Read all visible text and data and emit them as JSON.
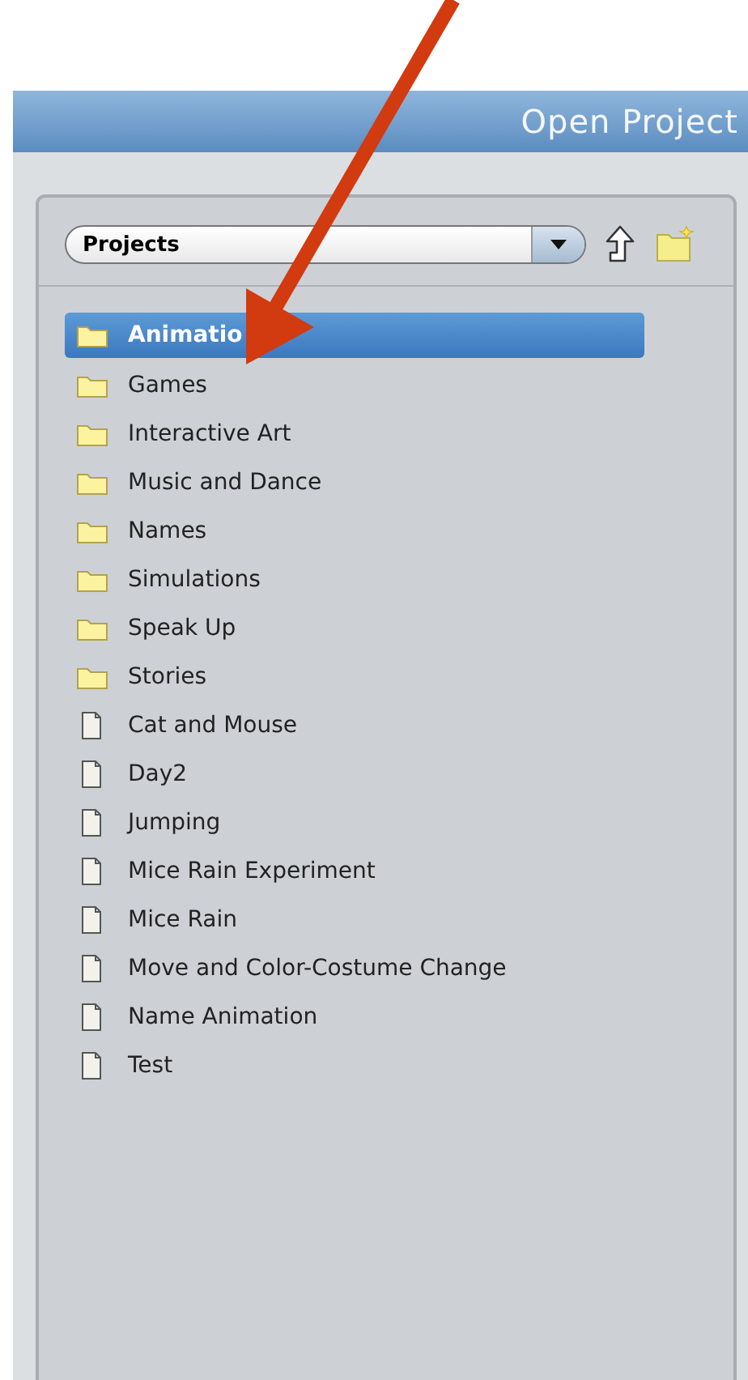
{
  "window": {
    "title": "Open Project"
  },
  "location": {
    "value": "Projects"
  },
  "items": [
    {
      "label": "Animatio",
      "kind": "folder",
      "selected": true
    },
    {
      "label": "Games",
      "kind": "folder",
      "selected": false
    },
    {
      "label": "Interactive Art",
      "kind": "folder",
      "selected": false
    },
    {
      "label": "Music and Dance",
      "kind": "folder",
      "selected": false
    },
    {
      "label": "Names",
      "kind": "folder",
      "selected": false
    },
    {
      "label": "Simulations",
      "kind": "folder",
      "selected": false
    },
    {
      "label": "Speak Up",
      "kind": "folder",
      "selected": false
    },
    {
      "label": "Stories",
      "kind": "folder",
      "selected": false
    },
    {
      "label": "Cat and Mouse",
      "kind": "file",
      "selected": false
    },
    {
      "label": "Day2",
      "kind": "file",
      "selected": false
    },
    {
      "label": "Jumping",
      "kind": "file",
      "selected": false
    },
    {
      "label": "Mice Rain Experiment",
      "kind": "file",
      "selected": false
    },
    {
      "label": "Mice Rain",
      "kind": "file",
      "selected": false
    },
    {
      "label": "Move and Color-Costume Change",
      "kind": "file",
      "selected": false
    },
    {
      "label": "Name Animation",
      "kind": "file",
      "selected": false
    },
    {
      "label": "Test",
      "kind": "file",
      "selected": false
    }
  ]
}
